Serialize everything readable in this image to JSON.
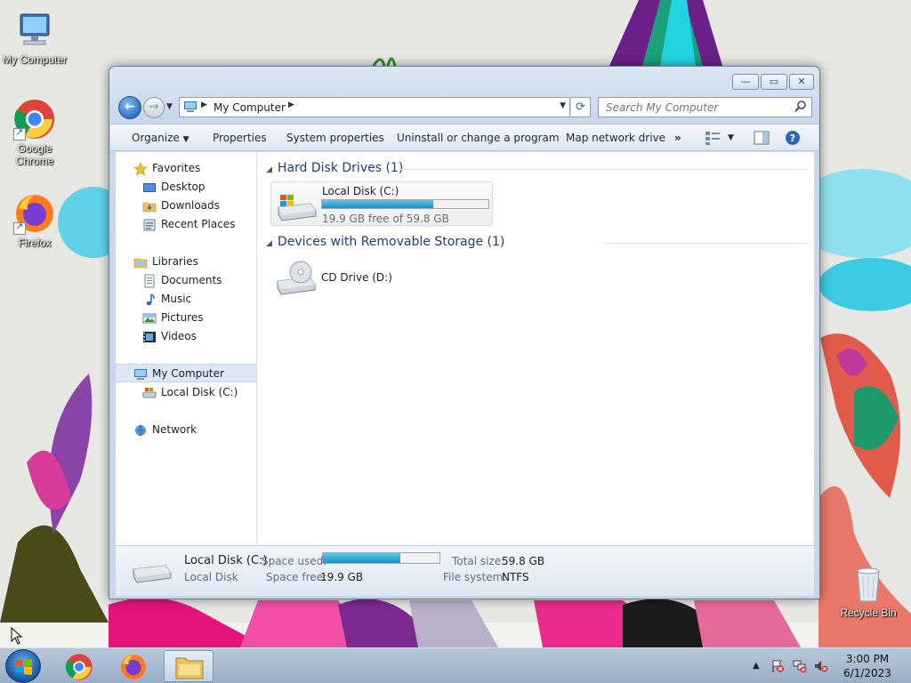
{
  "desktop": {
    "icons": [
      {
        "label": "My Computer",
        "icon": "computer-icon"
      },
      {
        "label": "Google Chrome",
        "icon": "chrome-icon"
      },
      {
        "label": "Firefox",
        "icon": "firefox-icon"
      },
      {
        "label": "Recycle Bin",
        "icon": "recycle-bin-icon"
      }
    ]
  },
  "window": {
    "address": {
      "crumb": "My Computer"
    },
    "search": {
      "placeholder": "Search My Computer"
    },
    "toolbar": {
      "organize": "Organize",
      "properties": "Properties",
      "system_properties": "System properties",
      "uninstall": "Uninstall or change a program",
      "map_drive": "Map network drive",
      "more": "»"
    },
    "nav": {
      "favorites": "Favorites",
      "desktop": "Desktop",
      "downloads": "Downloads",
      "recent": "Recent Places",
      "libraries": "Libraries",
      "documents": "Documents",
      "music": "Music",
      "pictures": "Pictures",
      "videos": "Videos",
      "my_computer": "My Computer",
      "local_disk": "Local Disk (C:)",
      "network": "Network"
    },
    "content": {
      "hdd_header": "Hard Disk Drives (1)",
      "removable_header": "Devices with Removable Storage (1)",
      "drive_c": {
        "name": "Local Disk (C:)",
        "free_text": "19.9 GB free of 59.8 GB",
        "used_fraction": 0.667
      },
      "drive_d": {
        "name": "CD Drive (D:)"
      }
    },
    "details": {
      "name": "Local Disk (C:)",
      "type": "Local Disk",
      "space_used_label": "Space used:",
      "space_free_label": "Space free:",
      "space_free": "19.9 GB",
      "total_size_label": "Total size:",
      "total_size": "59.8 GB",
      "fs_label": "File system:",
      "fs": "NTFS",
      "used_fraction": 0.667
    }
  },
  "taskbar": {
    "time": "3:00 PM",
    "date": "6/1/2023"
  },
  "colors": {
    "accent": "#1f8fbf",
    "nav_selected": "#dde8f5",
    "group_header": "#1e3c78"
  }
}
